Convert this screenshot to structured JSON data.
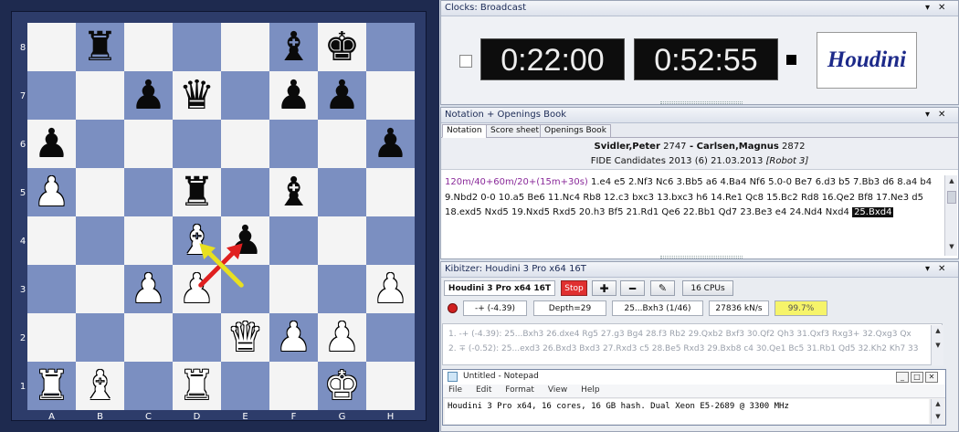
{
  "board": {
    "files": [
      "A",
      "B",
      "C",
      "D",
      "E",
      "F",
      "G",
      "H"
    ],
    "ranks": [
      "8",
      "7",
      "6",
      "5",
      "4",
      "3",
      "2",
      "1"
    ],
    "pieces": [
      {
        "sq": "b8",
        "p": "rook",
        "c": "b"
      },
      {
        "sq": "f8",
        "p": "bishop",
        "c": "b"
      },
      {
        "sq": "g8",
        "p": "king",
        "c": "b"
      },
      {
        "sq": "c7",
        "p": "pawn",
        "c": "b"
      },
      {
        "sq": "d7",
        "p": "queen",
        "c": "b"
      },
      {
        "sq": "f7",
        "p": "pawn",
        "c": "b"
      },
      {
        "sq": "g7",
        "p": "pawn",
        "c": "b"
      },
      {
        "sq": "a6",
        "p": "pawn",
        "c": "b"
      },
      {
        "sq": "h6",
        "p": "pawn",
        "c": "b"
      },
      {
        "sq": "a5",
        "p": "pawn",
        "c": "w"
      },
      {
        "sq": "d5",
        "p": "rook",
        "c": "b"
      },
      {
        "sq": "f5",
        "p": "bishop",
        "c": "b"
      },
      {
        "sq": "d4",
        "p": "bishop",
        "c": "w"
      },
      {
        "sq": "e4",
        "p": "pawn",
        "c": "b"
      },
      {
        "sq": "c3",
        "p": "pawn",
        "c": "w"
      },
      {
        "sq": "d3",
        "p": "pawn",
        "c": "w"
      },
      {
        "sq": "h3",
        "p": "pawn",
        "c": "w"
      },
      {
        "sq": "e2",
        "p": "queen",
        "c": "w"
      },
      {
        "sq": "f2",
        "p": "pawn",
        "c": "w"
      },
      {
        "sq": "g2",
        "p": "pawn",
        "c": "w"
      },
      {
        "sq": "a1",
        "p": "rook",
        "c": "w"
      },
      {
        "sq": "b1",
        "p": "bishop",
        "c": "w"
      },
      {
        "sq": "d1",
        "p": "rook",
        "c": "w"
      },
      {
        "sq": "g1",
        "p": "king",
        "c": "w"
      }
    ],
    "arrows": [
      {
        "from": "d3",
        "to": "e4",
        "color": "#e02020"
      },
      {
        "from": "e3",
        "to": "d4",
        "color": "#e8e020"
      }
    ]
  },
  "clocks": {
    "title": "Clocks: Broadcast",
    "white_time": "0:22:00",
    "black_time": "0:52:55",
    "engine_logo": "Houdini"
  },
  "notation": {
    "title": "Notation + Openings Book",
    "tabs": [
      "Notation",
      "Score sheet",
      "Openings Book"
    ],
    "white_player": "Svidler,Peter",
    "white_elo": "2747",
    "separator": " - ",
    "black_player": "Carlsen,Magnus",
    "black_elo": "2872",
    "event_line": "FIDE Candidates 2013 (6) 21.03.2013",
    "event_tag": "[Robot 3]",
    "time_control": "120m/40+60m/20+(15m+30s)",
    "moves_text": "1.e4 e5 2.Nf3 Nc6 3.Bb5 a6 4.Ba4 Nf6 5.0-0 Be7 6.d3 b5 7.Bb3 d6 8.a4 b4 9.Nbd2 0-0 10.a5 Be6 11.Nc4 Rb8 12.c3 bxc3 13.bxc3 h6 14.Re1 Qc8 15.Bc2 Rd8 16.Qe2 Bf8 17.Ne3 d5 18.exd5 Nxd5 19.Nxd5 Rxd5 20.h3 Bf5 21.Rd1 Qe6 22.Bb1 Qd7 23.Be3 e4 24.Nd4 Nxd4",
    "current_move": "25.Bxd4"
  },
  "kibitzer": {
    "title": "Kibitzer: Houdini 3 Pro x64 16T",
    "engine_name": "Houdini 3 Pro x64 16T",
    "stop_label": "Stop",
    "cpus_label": "16 CPUs",
    "eval": "-+ (-4.39)",
    "depth": "Depth=29",
    "current_line": "25...Bxh3 (1/46)",
    "speed": "27836 kN/s",
    "percent": "99.7%",
    "line1": "1. -+ (-4.39): 25...Bxh3 26.dxe4 Rg5 27.g3 Bg4 28.f3 Rb2 29.Qxb2 Bxf3 30.Qf2 Qh3 31.Qxf3 Rxg3+ 32.Qxg3 Qx",
    "line2": "2. ∓ (-0.52): 25...exd3 26.Bxd3 Bxd3 27.Rxd3 c5 28.Be5 Rxd3 29.Bxb8 c4 30.Qe1 Bc5 31.Rb1 Qd5 32.Kh2 Kh7 33"
  },
  "notepad": {
    "title": "Untitled - Notepad",
    "menu": [
      "File",
      "Edit",
      "Format",
      "View",
      "Help"
    ],
    "text": "Houdini 3 Pro x64, 16 cores, 16 GB hash. Dual Xeon E5-2689 @ 3300 MHz"
  },
  "colors": {
    "light_square": "#f4f4f4",
    "dark_square": "#7b8fc1",
    "frame": "#1e2a4f",
    "stop_button": "#e03030",
    "percent_bg": "#f6f46a"
  }
}
